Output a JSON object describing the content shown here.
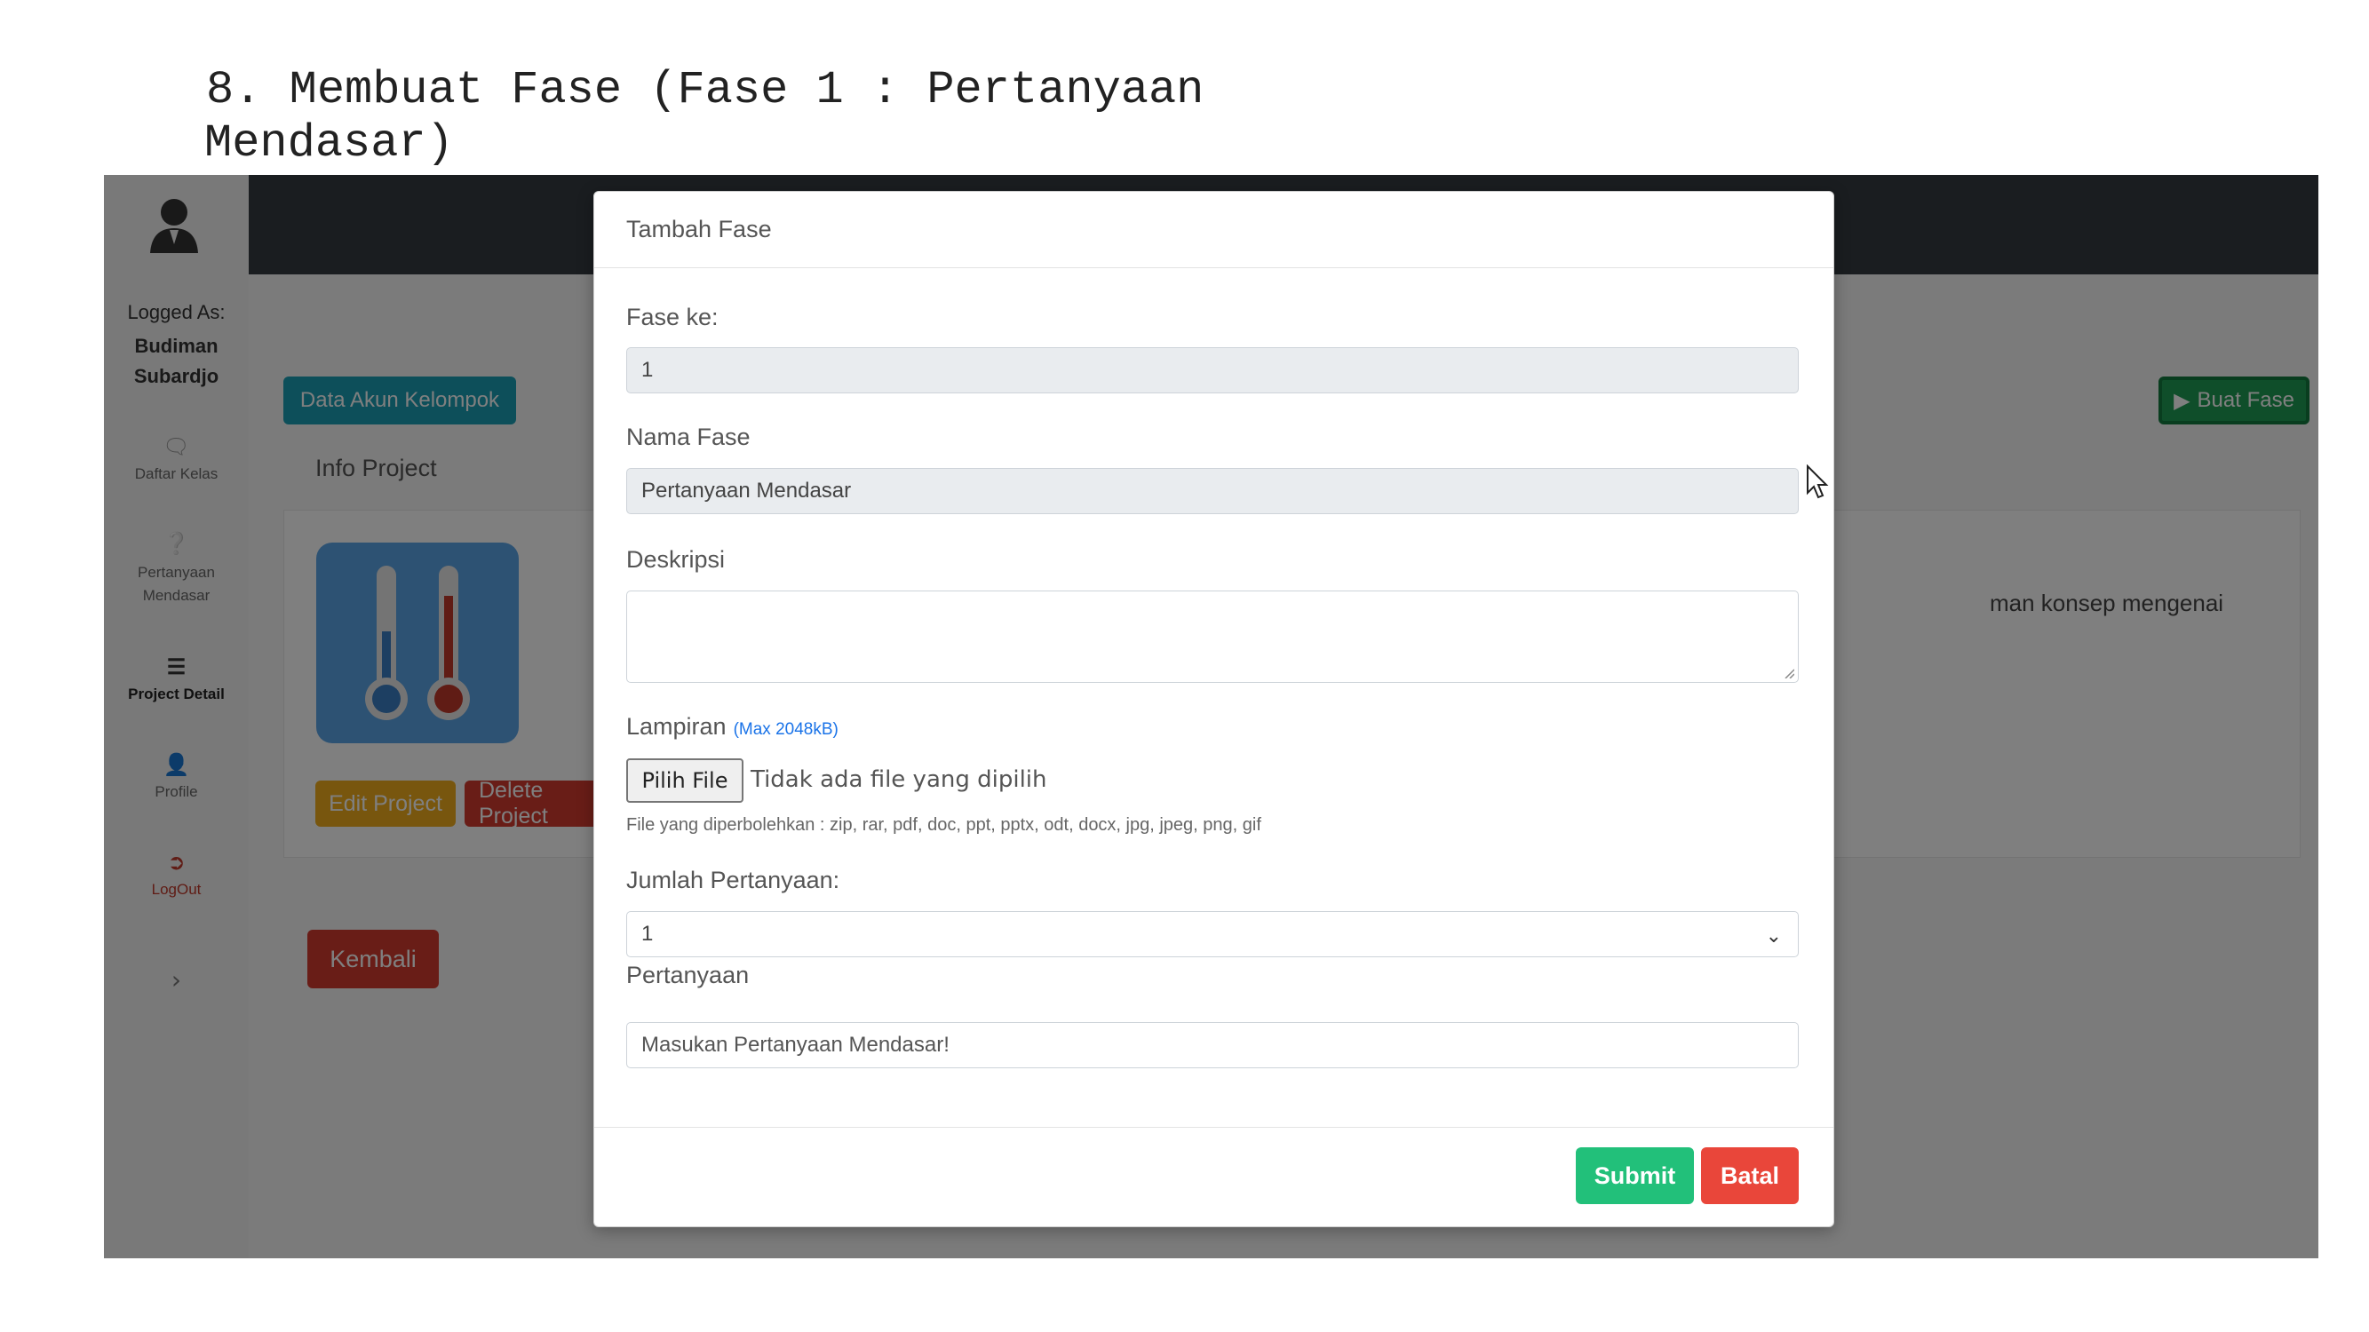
{
  "doc": {
    "heading_line1": "8. Membuat Fase (Fase 1 : Pertanyaan",
    "heading_line2": "Mendasar)"
  },
  "sidebar": {
    "logged_as_label": "Logged As:",
    "user_name_line1": "Budiman",
    "user_name_line2": "Subardjo",
    "items": [
      {
        "label": "Daftar Kelas",
        "icon": "chat-icon"
      },
      {
        "label": "Pertanyaan Mendasar",
        "icon": "question-icon"
      },
      {
        "label": "Project Detail",
        "icon": "list-icon"
      },
      {
        "label": "Profile",
        "icon": "user-edit-icon"
      },
      {
        "label": "LogOut",
        "icon": "signout-icon"
      }
    ],
    "expand_icon": "chevron-right-icon"
  },
  "page": {
    "data_akun_button": "Data Akun Kelompok",
    "buat_fase_button": "Buat Fase",
    "info_title": "Info Project",
    "edit_button": "Edit Project",
    "delete_button": "Delete Project",
    "card_text": "man konsep mengenai",
    "kembali_button": "Kembali"
  },
  "modal": {
    "title": "Tambah Fase",
    "fase_ke_label": "Fase ke:",
    "fase_ke_value": "1",
    "nama_fase_label": "Nama Fase",
    "nama_fase_value": "Pertanyaan Mendasar",
    "deskripsi_label": "Deskripsi",
    "deskripsi_value": "",
    "lampiran_label": "Lampiran",
    "lampiran_max": "(Max 2048kB)",
    "file_button": "Pilih File",
    "file_status": "Tidak ada file yang dipilih",
    "file_help": "File yang diperbolehkan : zip, rar, pdf, doc, ppt, pptx, odt, docx, jpg, jpeg, png, gif",
    "jumlah_label": "Jumlah Pertanyaan:",
    "jumlah_value": "1",
    "pertanyaan_label": "Pertanyaan",
    "pertanyaan_placeholder": "Masukan Pertanyaan Mendasar!",
    "submit_button": "Submit",
    "batal_button": "Batal"
  },
  "colors": {
    "topbar": "#343a40",
    "info_button": "#1a9fb4",
    "success": "#1f9d55",
    "warning": "#f0ad1d",
    "danger": "#d33a2f",
    "submit": "#22c07a",
    "batal": "#e9463a"
  }
}
